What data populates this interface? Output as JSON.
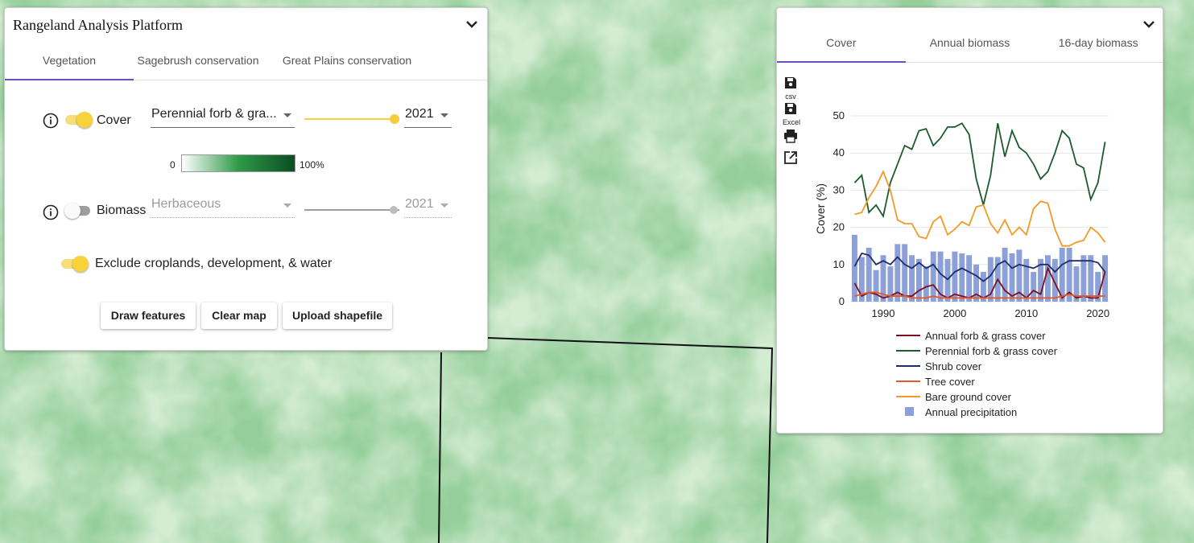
{
  "app": {
    "title": "Rangeland Analysis Platform"
  },
  "left_panel": {
    "tabs": [
      {
        "label": "Vegetation",
        "active": true
      },
      {
        "label": "Sagebrush conservation",
        "active": false
      },
      {
        "label": "Great Plains conservation",
        "active": false
      }
    ],
    "cover": {
      "label": "Cover",
      "enabled": true,
      "layer": "Perennial forb & gra...",
      "year": "2021"
    },
    "cover_legend": {
      "min": "0",
      "max": "100%"
    },
    "biomass": {
      "label": "Biomass",
      "enabled": false,
      "layer": "Herbaceous",
      "year": "2021"
    },
    "exclude": {
      "label": "Exclude croplands, development, & water",
      "enabled": true
    },
    "buttons": {
      "draw": "Draw features",
      "clear": "Clear map",
      "upload": "Upload shapefile"
    }
  },
  "right_panel": {
    "tabs": [
      {
        "label": "Cover",
        "active": true
      },
      {
        "label": "Annual biomass",
        "active": false
      },
      {
        "label": "16-day biomass",
        "active": false
      }
    ],
    "tools": [
      {
        "icon": "save-csv-icon",
        "caption": "csv"
      },
      {
        "icon": "save-excel-icon",
        "caption": "Excel"
      },
      {
        "icon": "print-icon",
        "caption": ""
      },
      {
        "icon": "open-external-icon",
        "caption": ""
      }
    ]
  },
  "chart_data": {
    "type": "line",
    "ylabel": "Cover (%)",
    "ylim": [
      0,
      50
    ],
    "yticks": [
      0,
      10,
      20,
      30,
      40,
      50
    ],
    "xlim": [
      1986,
      2021
    ],
    "xticks": [
      1990,
      2000,
      2010,
      2020
    ],
    "x": [
      1986,
      1987,
      1988,
      1989,
      1990,
      1991,
      1992,
      1993,
      1994,
      1995,
      1996,
      1997,
      1998,
      1999,
      2000,
      2001,
      2002,
      2003,
      2004,
      2005,
      2006,
      2007,
      2008,
      2009,
      2010,
      2011,
      2012,
      2013,
      2014,
      2015,
      2016,
      2017,
      2018,
      2019,
      2020,
      2021
    ],
    "series": [
      {
        "name": "Annual forb & grass cover",
        "type": "line",
        "color": "#7b1020",
        "values": [
          5,
          1.5,
          2.5,
          2,
          1,
          1.5,
          2.5,
          1.5,
          1.5,
          3,
          4,
          4.5,
          2,
          1,
          2,
          1.5,
          1,
          2,
          1,
          2,
          6,
          3,
          1.5,
          2.5,
          1,
          3,
          2,
          9,
          5,
          1,
          2.5,
          1,
          1.5,
          1,
          1,
          8
        ]
      },
      {
        "name": "Perennial forb & grass cover",
        "type": "line",
        "color": "#1d5a2e",
        "values": [
          32,
          34,
          24,
          26,
          23,
          32,
          37,
          42,
          41,
          46,
          46.5,
          42,
          44,
          47,
          47,
          48,
          45,
          33,
          26,
          34,
          48,
          39,
          46,
          41.5,
          40,
          37,
          33,
          35,
          40,
          46,
          44,
          37,
          36,
          27.5,
          32,
          43
        ]
      },
      {
        "name": "Shrub cover",
        "type": "line",
        "color": "#1e2e6a",
        "values": [
          9.5,
          13,
          12.5,
          10,
          11,
          10,
          12,
          10,
          9,
          10.5,
          9,
          10,
          7.5,
          6,
          8,
          9,
          8,
          7,
          5.5,
          7,
          10,
          11,
          9,
          10,
          9.5,
          9,
          10,
          10,
          8,
          10,
          11,
          11,
          11,
          11,
          10.5,
          8
        ]
      },
      {
        "name": "Tree cover",
        "type": "line",
        "color": "#e05a2a",
        "values": [
          1.5,
          2,
          2.5,
          2.5,
          2,
          1.5,
          1.5,
          1.5,
          1,
          1,
          1,
          1.5,
          1,
          1,
          1,
          1,
          1,
          1,
          1,
          1,
          1,
          1,
          1,
          1,
          1,
          1,
          1,
          1,
          1,
          1.5,
          2,
          1.5,
          1.5,
          1.5,
          1.5,
          1.5
        ]
      },
      {
        "name": "Bare ground cover",
        "type": "line",
        "color": "#f39a26",
        "values": [
          23.5,
          24,
          28,
          31,
          35,
          30,
          22,
          21,
          21,
          17.5,
          17,
          21.5,
          23,
          18,
          19.5,
          21.5,
          20.5,
          25.5,
          26,
          21,
          18.5,
          22,
          18,
          20,
          18,
          25,
          27,
          26.5,
          19.5,
          15,
          15,
          16,
          16.5,
          20,
          18.5,
          16
        ]
      },
      {
        "name": "Annual precipitation",
        "type": "bar",
        "color": "#8ea0d8",
        "values": [
          18,
          12,
          14.5,
          8.5,
          12.5,
          9.5,
          15.5,
          15.5,
          12.5,
          11.5,
          9.5,
          13.5,
          13.5,
          11.5,
          13.5,
          13,
          12.5,
          10,
          8,
          12,
          12,
          14.5,
          13,
          14,
          11.5,
          8,
          11.5,
          12.5,
          11.5,
          14.5,
          14.5,
          9.5,
          12.5,
          12.5,
          8,
          12.5
        ]
      }
    ]
  }
}
